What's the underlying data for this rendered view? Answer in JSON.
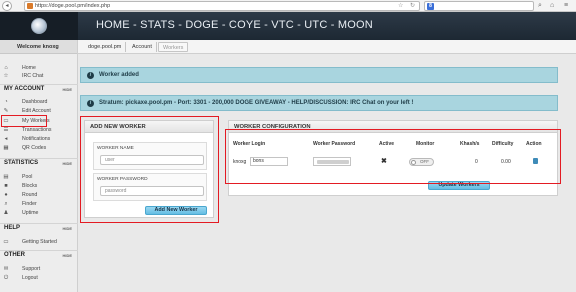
{
  "browser": {
    "url": "https://doge.pool.pm/index.php",
    "search_engine_glyph": "8",
    "icons": [
      "back-icon",
      "star-icon",
      "refresh-icon",
      "search-icon",
      "home-icon",
      "bookmark-icon",
      "menu-icon"
    ]
  },
  "header": {
    "title": "HOME - STATS - DOGE - COYE - VTC - UTC - MOON"
  },
  "sidebar": {
    "welcome": "Welcome knoxg",
    "top_items": [
      {
        "label": "Home",
        "icon": "home-icon",
        "glyph": "⌂"
      },
      {
        "label": "IRC Chat",
        "icon": "star-icon",
        "glyph": "☆"
      }
    ],
    "my_account": {
      "title": "MY ACCOUNT",
      "hide": "HIDE",
      "items": [
        {
          "label": "Dashboard",
          "icon": "dashboard-icon",
          "glyph": "◔"
        },
        {
          "label": "Edit Account",
          "icon": "edit-icon",
          "glyph": "✎"
        },
        {
          "label": "My Workers",
          "icon": "monitor-icon",
          "glyph": "▭"
        },
        {
          "label": "Transactions",
          "icon": "transactions-icon",
          "glyph": "☰"
        },
        {
          "label": "Notifications",
          "icon": "notifications-icon",
          "glyph": "◂"
        },
        {
          "label": "QR Codes",
          "icon": "qr-icon",
          "glyph": "▦"
        }
      ]
    },
    "statistics": {
      "title": "STATISTICS",
      "hide": "HIDE",
      "items": [
        {
          "label": "Pool",
          "icon": "pool-icon",
          "glyph": "▤"
        },
        {
          "label": "Blocks",
          "icon": "blocks-icon",
          "glyph": "■"
        },
        {
          "label": "Round",
          "icon": "round-icon",
          "glyph": "●"
        },
        {
          "label": "Finder",
          "icon": "finder-icon",
          "glyph": "⌕"
        },
        {
          "label": "Uptime",
          "icon": "uptime-icon",
          "glyph": "♟"
        }
      ]
    },
    "help": {
      "title": "HELP",
      "hide": "HIDE",
      "items": [
        {
          "label": "Getting Started",
          "icon": "getting-started-icon",
          "glyph": "▭"
        }
      ]
    },
    "other": {
      "title": "OTHER",
      "hide": "HIDE",
      "items": [
        {
          "label": "Support",
          "icon": "support-icon",
          "glyph": "✉"
        },
        {
          "label": "Logout",
          "icon": "logout-icon",
          "glyph": "⏻"
        }
      ]
    }
  },
  "breadcrumb": [
    "doge.pool.pm",
    "Account",
    "Workers"
  ],
  "alerts": {
    "worker_added": "Worker added",
    "stratum": "Stratum: pickaxe.pool.pm - Port: 3301 - 200,000 DOGE GIVEAWAY - HELP/DISCUSSION: IRC Chat on your left !",
    "icon": "info-icon"
  },
  "add_worker": {
    "title": "ADD NEW WORKER",
    "name_label": "WORKER NAME",
    "name_placeholder": "user",
    "password_label": "WORKER PASSWORD",
    "password_placeholder": "password",
    "button": "Add New Worker"
  },
  "worker_config": {
    "title": "WORKER CONFIGURATION",
    "columns": [
      "Worker Login",
      "Worker Password",
      "Active",
      "Monitor",
      "Khash/s",
      "Difficulty",
      "Action"
    ],
    "row": {
      "login_prefix": "knoxg",
      "login_value": "bons",
      "active": "✖",
      "monitor": "OFF",
      "khash": "0",
      "difficulty": "0.00"
    },
    "button": "Update Workers"
  },
  "colors": {
    "header_bg": "#1d2833",
    "alert_bg": "#a9d5df",
    "button_bg": "#64bde3",
    "highlight": "#e31b23"
  }
}
